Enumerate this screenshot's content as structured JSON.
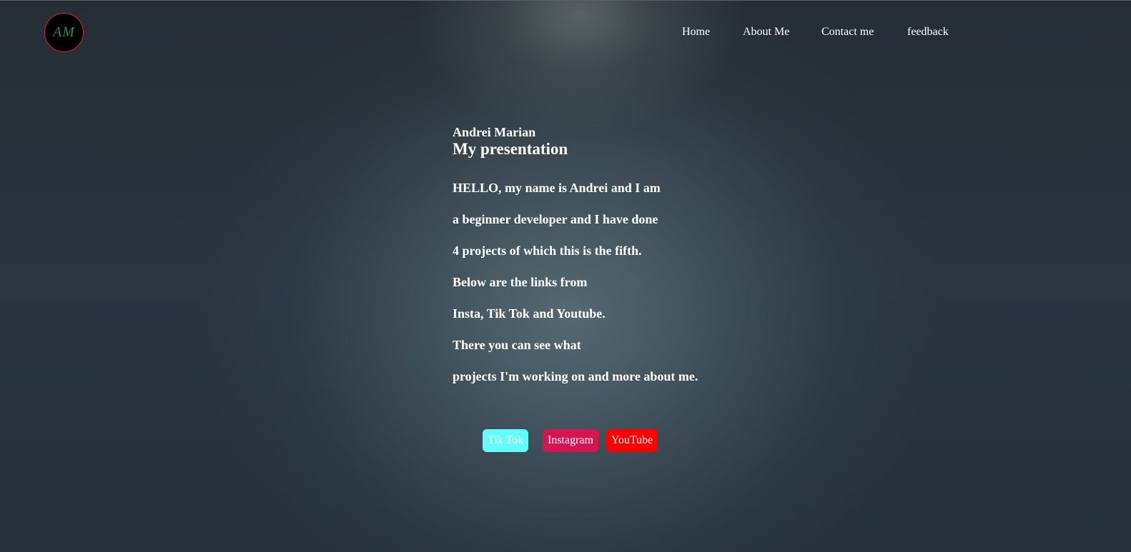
{
  "logo": {
    "initials": "AM"
  },
  "nav": [
    {
      "label": "Home"
    },
    {
      "label": "About Me"
    },
    {
      "label": "Contact me"
    },
    {
      "label": "feedback"
    }
  ],
  "hero": {
    "name": "Andrei Marian",
    "title": "My presentation",
    "lines": [
      "HELLO, my name is Andrei and I am",
      "a beginner developer and I have done",
      "4 projects of which this is the fifth.",
      "Below are the links from",
      "Insta, Tik Tok and Youtube.",
      "There you can see what",
      "projects I'm working on and more about me."
    ]
  },
  "social": {
    "tiktok": "Tik Tok",
    "instagram": "Instagram",
    "youtube": "YouTube"
  },
  "colors": {
    "tiktok": "#62fdfb",
    "instagram": "#d51451",
    "youtube": "#ff0000",
    "logo_border": "#d81b3c",
    "logo_text": "#2e8b3a"
  }
}
